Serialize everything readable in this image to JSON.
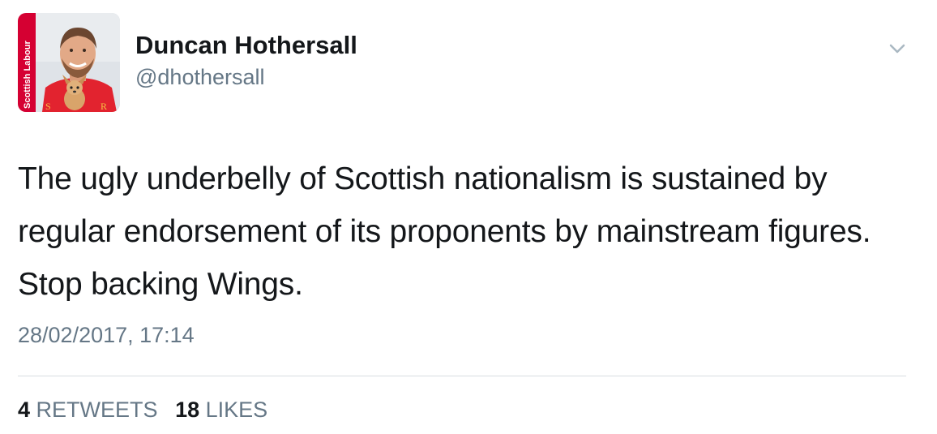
{
  "tweet": {
    "author": {
      "display_name": "Duncan Hothersall",
      "handle": "@dhothersall",
      "avatar_badge_text": "Scottish Labour"
    },
    "text": "The ugly underbelly of Scottish nationalism is sustained by regular endorsement of its proponents by mainstream figures. Stop backing Wings.",
    "timestamp": "28/02/2017, 17:14",
    "stats": {
      "retweets_count": "4",
      "retweets_label": "RETWEETS",
      "likes_count": "18",
      "likes_label": "LIKES"
    },
    "menu_icon": "chevron-down-icon"
  },
  "colors": {
    "text_primary": "#14171a",
    "text_secondary": "#657786",
    "divider": "#d8dde1",
    "badge_red": "#d50032"
  }
}
